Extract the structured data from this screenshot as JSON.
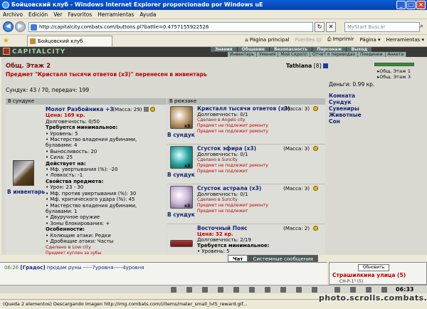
{
  "window": {
    "title": "Бойцовский клуб - Windows Internet Explorer proporcionado por Windows uE"
  },
  "menu": [
    "Archivo",
    "Edición",
    "Ver",
    "Favoritos",
    "Herramientas",
    "Ayuda"
  ],
  "address": {
    "url": "http://capitalcity.combats.com/buttons.pl?battle=0.4757155922526",
    "search_placeholder": "MyStart Buscar"
  },
  "tab": {
    "label": "Бойцовский клуб"
  },
  "commands": {
    "home": "Página principal",
    "feeds": "Fuentes (J)",
    "print": "Imprimir",
    "page": "Página",
    "tools": "Herramientas"
  },
  "game": {
    "logo": "CAPITALCITY",
    "nav_top": [
      "Знания",
      "Общение",
      "Безопасность",
      "Персонаж",
      "Выход"
    ],
    "nav_sub": [
      "Инвентарь",
      "Умения",
      "Мой Скролл",
      "Отчет о переводах",
      "Поединки",
      "Анкета"
    ]
  },
  "location": {
    "title": "Общ. Этаж 2",
    "notice": "Предмет \"Кристалл тысячи ответов (х3)\" перенесен в инвентарь"
  },
  "player": {
    "name": "Tathiana",
    "level": "[8]"
  },
  "rooms": [
    "Общ. Этаж 1",
    "Общ. Этаж 3"
  ],
  "chest": {
    "weight": "Сундук: 43 / 70, передач: 199"
  },
  "money": "Деньги: 0.99 кр.",
  "side_links": [
    "Комната",
    "Сундук",
    "Сувениры",
    "Животные",
    "Сон"
  ],
  "columns": {
    "left": "В сундуке",
    "right": "В рюкзаке"
  },
  "left_item": {
    "inventory_link": "В инвентарь",
    "name": "Молот Разбойника +3",
    "mass": "(Масса: 29)",
    "price": "Цена: 169 кр.",
    "durability": "Долговечность: 0/50",
    "req_header": "Требуется минимальное:",
    "reqs": [
      "• Уровень: 5",
      "• Мастерство владения дубинами, булавами: 4",
      "• Выносливость: 20",
      "• Сила: 25"
    ],
    "acts_header": "Действует на:",
    "acts": [
      "• Мф. увертывания (%): -20",
      "• Ловкость: -1"
    ],
    "props_header": "Свойства предмета:",
    "props": [
      "• Урон: 23 - 30",
      "• Мф. против увертывания (%): 30",
      "• Мф. критического удара (%): 45",
      "• Мастерство владения дубинами, булавами: 1",
      "• Двуручное оружие",
      "• Зоны блокирования: +"
    ],
    "feat_header": "Особенности:",
    "feats": [
      "• Колющие атаки: Редки",
      "• Дробящие атаки: Часты"
    ],
    "made": "Сделано в Low city",
    "bought": "Предмет куплен за зубы"
  },
  "right_items": [
    {
      "name": "Кристалл тысячи ответов (х3)",
      "mass": "(Масса: 3)",
      "qty": "x3",
      "durability": "Долговечность: 0/1",
      "made": "Сделано в Angels city",
      "note1": "Предмет не подлежит ремонту",
      "note2": "Предмет не подлежит ремонту",
      "link": "В сундук"
    },
    {
      "name": "Сгусток эфира (х3)",
      "mass": "(Масса: 3)",
      "qty": "x3",
      "durability": "Долговечность: 0/1",
      "made": "Сделано в Suncity",
      "note1": "Предмет не подлежит ремонту",
      "note2": "Предмет не подлежит",
      "link": "В сундук"
    },
    {
      "name": "Сгусток астрала (х3)",
      "mass": "(Масса: 3)",
      "qty": "x3",
      "durability": "Долговечность: 0/1",
      "made": "Сделано в Suncity",
      "note1": "Предмет не подлежит ремонту",
      "note2": "Предмет не подлежит",
      "link": "В сундук"
    },
    {
      "name": "Восточный Пояс",
      "mass": "(Масса: 2)",
      "qty": "",
      "price": "Цена: 32 кр.",
      "durability": "Долговечность: 2/19",
      "req_header": "Требуется минимальное:",
      "req1": "• Уровень: 5"
    }
  ],
  "chat": {
    "tab_chat": "Чат",
    "tab_system": "Системные сообщения",
    "time": "06:26",
    "nick": "[Градос]",
    "message": "продам руны -----7уровня-----4уровня"
  },
  "side_panel": {
    "refresh": "Обновить",
    "street": "Страшилкина улица (5)",
    "sub": "СН-Р-1³ (5)"
  },
  "clock": "06:33",
  "status": "(Queda 2 elementos) Descargando imagen http://img.combats.com/i/items/mater_small_lvl5_reward.gif...",
  "watermark": "photo.scrolls.combats.com"
}
